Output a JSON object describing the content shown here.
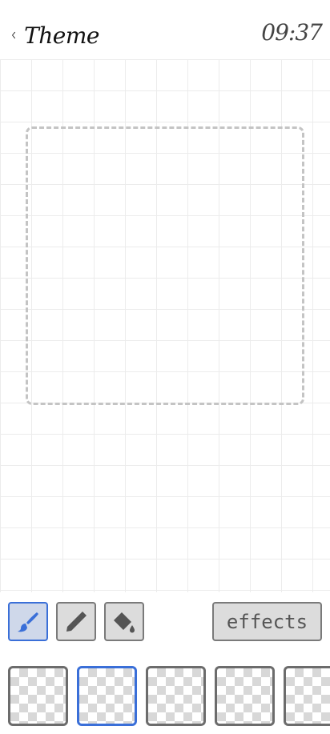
{
  "header": {
    "title": "Theme",
    "time": "09:37"
  },
  "toolbar": {
    "tools": [
      {
        "name": "brush",
        "active": true
      },
      {
        "name": "pencil",
        "active": false
      },
      {
        "name": "fill-bucket",
        "active": false
      }
    ],
    "effects_label": "effects"
  },
  "frames": {
    "count_visible": 5,
    "selected_index": 1
  },
  "colors": {
    "accent": "#3a6fd8",
    "button_bg": "#dcdcdc",
    "border": "#7a7a7a",
    "grid": "#ececec"
  }
}
